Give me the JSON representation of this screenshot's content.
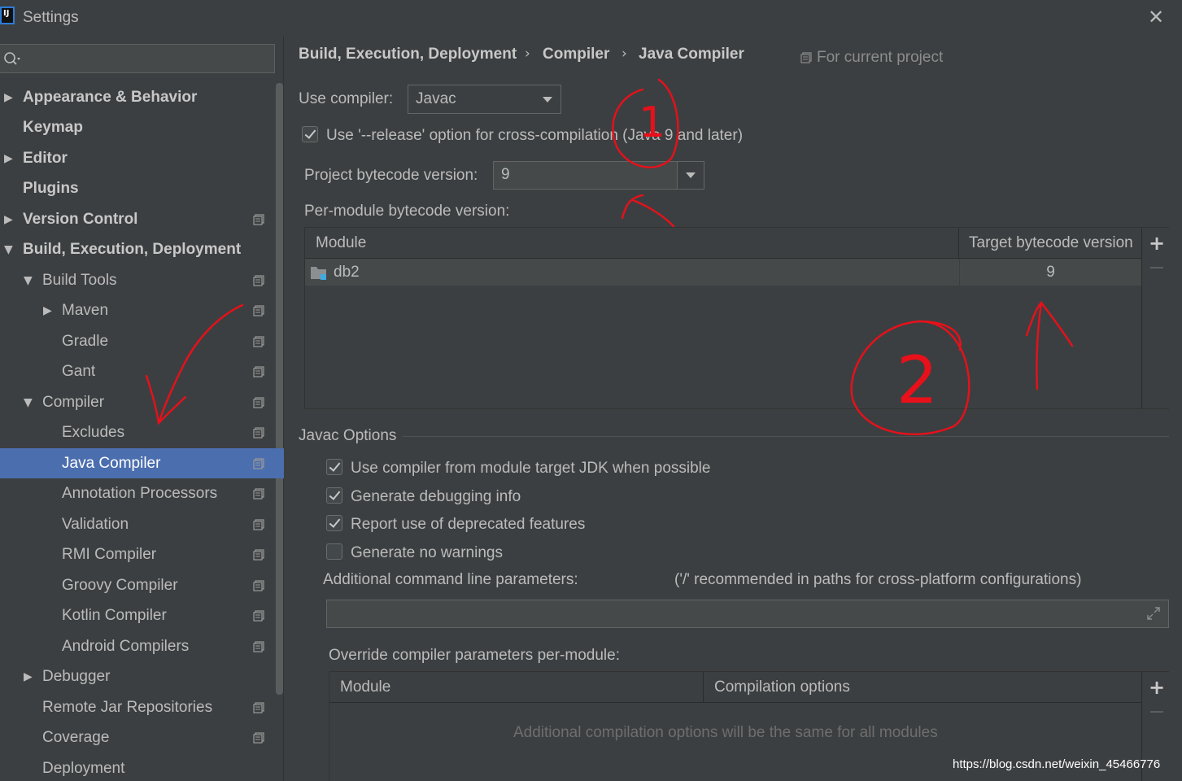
{
  "window": {
    "title": "Settings",
    "app_icon_text": "IJ"
  },
  "search": {
    "placeholder": ""
  },
  "sidebar": {
    "items": [
      {
        "label": "Appearance & Behavior",
        "bold": true,
        "arrow": "▶"
      },
      {
        "label": "Keymap",
        "bold": true
      },
      {
        "label": "Editor",
        "bold": true,
        "arrow": "▶"
      },
      {
        "label": "Plugins",
        "bold": true
      },
      {
        "label": "Version Control",
        "bold": true,
        "arrow": "▶"
      },
      {
        "label": "Build, Execution, Deployment",
        "bold": true,
        "arrow": "▼"
      },
      {
        "label": "Build Tools",
        "arrow": "▼"
      },
      {
        "label": "Maven",
        "arrow": "▶"
      },
      {
        "label": "Gradle"
      },
      {
        "label": "Gant"
      },
      {
        "label": "Compiler",
        "arrow": "▼"
      },
      {
        "label": "Excludes"
      },
      {
        "label": "Java Compiler",
        "selected": true
      },
      {
        "label": "Annotation Processors"
      },
      {
        "label": "Validation"
      },
      {
        "label": "RMI Compiler"
      },
      {
        "label": "Groovy Compiler"
      },
      {
        "label": "Kotlin Compiler"
      },
      {
        "label": "Android Compilers"
      },
      {
        "label": "Debugger",
        "arrow": "▶"
      },
      {
        "label": "Remote Jar Repositories"
      },
      {
        "label": "Coverage"
      },
      {
        "label": "Deployment"
      }
    ]
  },
  "breadcrumb": {
    "items": [
      "Build, Execution, Deployment",
      "Compiler",
      "Java Compiler"
    ],
    "separator": "›",
    "scope": "For current project"
  },
  "compiler": {
    "use_compiler_label": "Use compiler:",
    "use_compiler_value": "Javac",
    "release_option_label": "Use '--release' option for cross-compilation (Java 9 and later)",
    "release_option_checked": true,
    "project_bytecode_label": "Project bytecode version:",
    "project_bytecode_value": "9",
    "per_module_label": "Per-module bytecode version:"
  },
  "bytecode_table": {
    "columns": [
      "Module",
      "Target bytecode version"
    ],
    "rows": [
      {
        "module": "db2",
        "target": "9"
      }
    ],
    "add_label": "+"
  },
  "javac_options": {
    "title": "Javac Options",
    "checkboxes": [
      {
        "label": "Use compiler from module target JDK when possible",
        "checked": true
      },
      {
        "label": "Generate debugging info",
        "checked": true
      },
      {
        "label": "Report use of deprecated features",
        "checked": true
      },
      {
        "label": "Generate no warnings",
        "checked": false
      }
    ],
    "additional_params_label": "Additional command line parameters:",
    "additional_params_hint": "('/' recommended in paths for cross-platform configurations)",
    "additional_params_value": "",
    "override_label": "Override compiler parameters per-module:"
  },
  "override_table": {
    "columns": [
      "Module",
      "Compilation options"
    ],
    "empty_text": "Additional compilation options will be the same for all modules",
    "add_label": "+"
  },
  "annotations": {
    "circle1_text": "1",
    "circle2_text": "2"
  },
  "watermark": "https://blog.csdn.net/weixin_45466776",
  "colors": {
    "selection": "#4b6eaf",
    "background": "#3c3f41",
    "annotation_red": "#e8101a"
  }
}
